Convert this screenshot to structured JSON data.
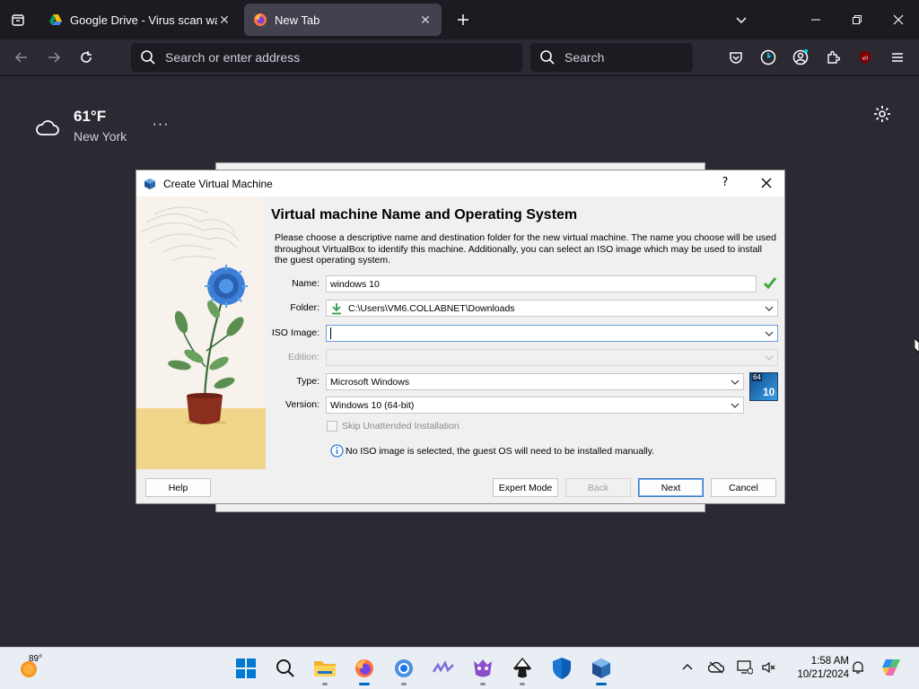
{
  "browser": {
    "tabs": [
      {
        "title": "Google Drive - Virus scan warni",
        "favicon": "google-drive-icon",
        "active": false
      },
      {
        "title": "New Tab",
        "favicon": "firefox-icon",
        "active": true
      }
    ],
    "urlbar_placeholder": "Search or enter address",
    "searchbar_placeholder": "Search"
  },
  "newtab": {
    "weather": {
      "temp": "61°F",
      "city": "New York",
      "more": "···"
    }
  },
  "dialog": {
    "title": "Create Virtual Machine",
    "help_glyph": "?",
    "heading": "Virtual machine Name and Operating System",
    "description": "Please choose a descriptive name and destination folder for the new virtual machine. The name you choose will be used throughout VirtualBox to identify this machine. Additionally, you can select an ISO image which may be used to install the guest operating system.",
    "fields": {
      "name": {
        "label": "Name:",
        "value": "windows 10"
      },
      "folder": {
        "label": "Folder:",
        "value": "C:\\Users\\VM6.COLLABNET\\Downloads"
      },
      "iso": {
        "label": "ISO Image:",
        "value": ""
      },
      "edition": {
        "label": "Edition:",
        "value": ""
      },
      "type": {
        "label": "Type:",
        "value": "Microsoft Windows"
      },
      "version": {
        "label": "Version:",
        "value": "Windows 10 (64-bit)"
      }
    },
    "os_badge": {
      "bits": "64",
      "ver": "10"
    },
    "skip_unattended": {
      "label": "Skip Unattended Installation",
      "checked": false,
      "enabled": false
    },
    "info_message": "No ISO image is selected, the guest OS will need to be installed manually.",
    "buttons": {
      "help": "Help",
      "expert": "Expert Mode",
      "back": "Back",
      "next": "Next",
      "cancel": "Cancel"
    }
  },
  "taskbar": {
    "weather_temp": "89°",
    "apps": [
      "windows-start",
      "search",
      "file-explorer",
      "firefox",
      "chrome",
      "linear",
      "game-app",
      "inkscape",
      "windows-security",
      "virtualbox"
    ],
    "clock": {
      "time": "1:58 AM",
      "date": "10/21/2024"
    }
  }
}
